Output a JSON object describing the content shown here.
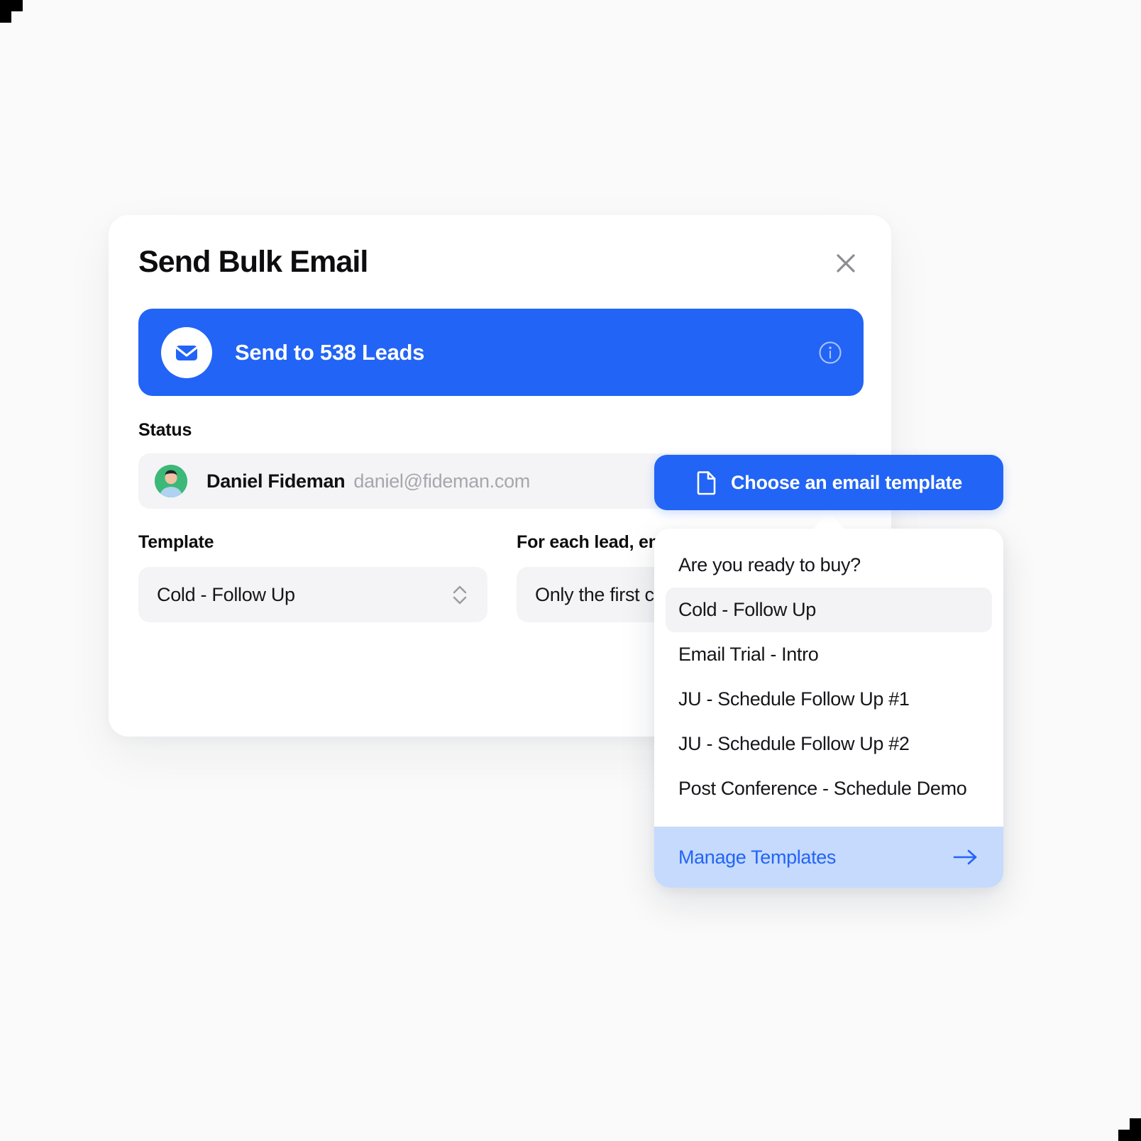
{
  "modal": {
    "title": "Send Bulk Email",
    "close_icon": "close-icon",
    "banner": {
      "icon": "envelope-icon",
      "label": "Send to 538 Leads",
      "info_icon": "info-circle-icon",
      "accent_color": "#2264f5"
    },
    "status": {
      "label": "Status",
      "name": "Daniel Fideman",
      "email": "daniel@fideman.com",
      "avatar": "user-avatar"
    },
    "template_field": {
      "label": "Template",
      "value": "Cold - Follow Up",
      "stepper_icon": "chevron-up-down-icon"
    },
    "foreach_field": {
      "label": "For each lead, em",
      "value": "Only the first c",
      "stepper_icon": "chevron-up-down-icon"
    }
  },
  "choose_button": {
    "label": "Choose an email template",
    "icon": "document-icon"
  },
  "dropdown": {
    "items": [
      {
        "label": "Are you ready to buy?",
        "selected": false
      },
      {
        "label": "Cold - Follow Up",
        "selected": true
      },
      {
        "label": "Email Trial - Intro",
        "selected": false
      },
      {
        "label": "JU - Schedule Follow Up #1",
        "selected": false
      },
      {
        "label": "JU - Schedule Follow Up #2",
        "selected": false
      },
      {
        "label": "Post Conference - Schedule Demo",
        "selected": false
      }
    ],
    "footer": {
      "label": "Manage Templates",
      "arrow_icon": "arrow-right-icon",
      "background_color": "#c5dafd",
      "text_color": "#2264f5"
    }
  }
}
